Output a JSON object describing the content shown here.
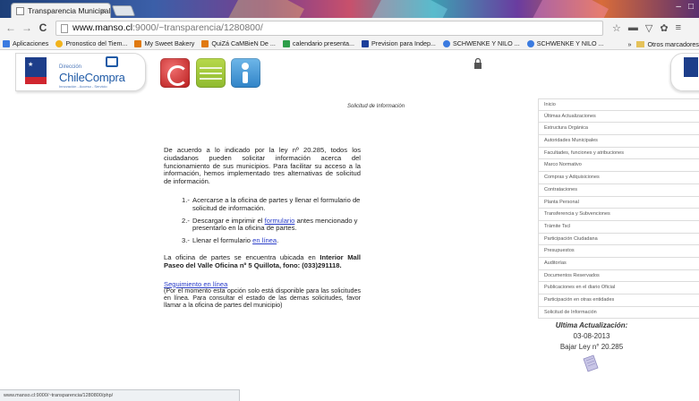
{
  "browser": {
    "tab_title": "Transparencia Municipal",
    "tab_close": "×",
    "url_host": "www.manso.cl",
    "url_path": ":9000/~transparencia/1280800/",
    "nav": {
      "back": "←",
      "forward": "→",
      "reload": "C"
    },
    "bookmarks": [
      {
        "label": "Aplicaciones",
        "color": "#3b7be0"
      },
      {
        "label": "Pronostico del Tiem...",
        "color": "#f2b31b"
      },
      {
        "label": "My Sweet Bakery",
        "color": "#e07a10"
      },
      {
        "label": "QuiZá CaMBieN De ...",
        "color": "#e07a10"
      },
      {
        "label": "calendario presenta...",
        "color": "#2e9e4a"
      },
      {
        "label": "Prevision para Indep...",
        "color": "#1c3f9a"
      },
      {
        "label": "SCHWENKE Y NILO ...",
        "color": "#3b7be0"
      },
      {
        "label": "SCHWENKE Y NILO ...",
        "color": "#3b7be0"
      }
    ],
    "other_bookmarks": "Otros marcadores",
    "status_url": "www.manso.cl:9000/~transparencia/1280800/php/"
  },
  "header": {
    "logo_dir": "Dirección",
    "logo_name": "ChileCompra",
    "logo_tagline": "Innovación - Acceso - Servicio",
    "icons": [
      "red-app-icon",
      "green-tramites-icon",
      "blue-info-icon"
    ]
  },
  "main": {
    "title": "Solicitud de Información",
    "intro": "De acuerdo a lo indicado por la ley nº 20.285, todos los ciudadanos pueden solicitar información acerca del funcionamiento de sus municipios. Para facilitar su acceso a la información, hemos implementado tres alternativas de solicitud de información.",
    "steps": [
      {
        "num": "1.-",
        "text": "Acercarse a la oficina de partes y llenar el formulario de solicitud de información."
      },
      {
        "num": "2.-",
        "pre": "Descargar e imprimir el ",
        "link": "formulario",
        "post": " antes mencionado y presentarlo en la oficina de partes."
      },
      {
        "num": "3.-",
        "pre": "Llenar el formulario ",
        "link": "en línea",
        "post": "."
      }
    ],
    "address_pre": "La oficina de partes se encuentra ubicada en ",
    "address_bold": "Interior Mall Paseo del Valle Oficina nº 5 Quillota, fono: (033)291118.",
    "seguimiento_link": "Seguimiento en línea",
    "seguimiento_note": "(Por el momento esta opción solo está disponible para las solicitudes en línea. Para consultar el estado de las demas solicitudes, favor llamar a la oficina de partes del municipio)"
  },
  "sidebar": {
    "items": [
      "Inicio",
      "Últimas Actualizaciones",
      "Estructura Orgánica",
      "Autoridades Municipales",
      "Facultades, funciones y atribuciones",
      "Marco Normativo",
      "Compras y Adquisiciones",
      "Contrataciones",
      "Planta Personal",
      "Transferencia y Subvenciones",
      "Trámite Tscl",
      "Participación Ciudadana",
      "Presupuestos",
      "Auditorías",
      "Documentos Reservados",
      "Publicaciones en el diario Oficial",
      "Participación en otras entidades",
      "Solicitud de Información"
    ],
    "update_label": "Ultima Actualización:",
    "update_date": "03-08-2013",
    "update_law": "Bajar Ley n° 20.285"
  }
}
